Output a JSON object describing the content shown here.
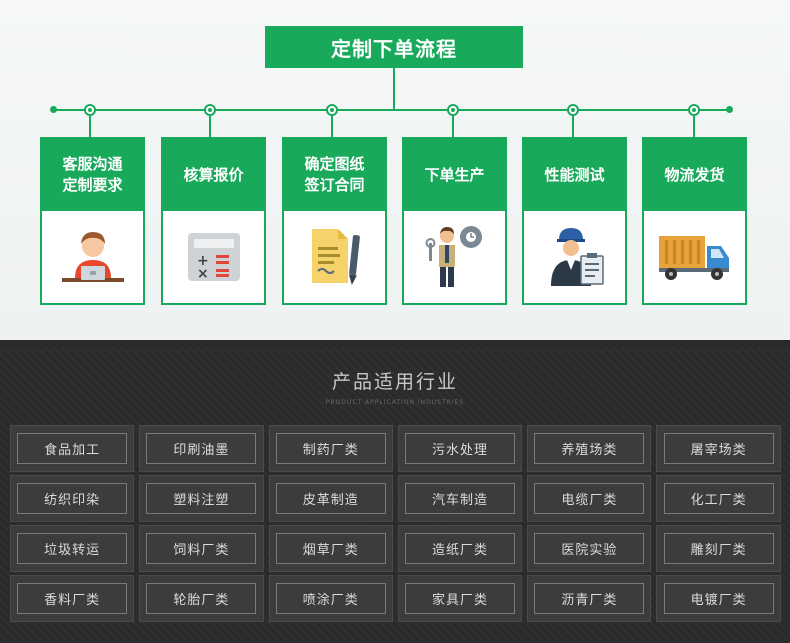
{
  "process": {
    "title": "定制下单流程",
    "steps": [
      {
        "label": "客服沟通\n定制要求",
        "icon": "customer-service-icon"
      },
      {
        "label": "核算报价",
        "icon": "calculator-icon"
      },
      {
        "label": "确定图纸\n签订合同",
        "icon": "contract-icon"
      },
      {
        "label": "下单生产",
        "icon": "production-icon"
      },
      {
        "label": "性能测试",
        "icon": "inspection-icon"
      },
      {
        "label": "物流发货",
        "icon": "delivery-truck-icon"
      }
    ]
  },
  "industries": {
    "title": "产品适用行业",
    "subtitle": "PRODUCT APPLICATION INDUSTRIES",
    "items": [
      "食品加工",
      "印刷油墨",
      "制药厂类",
      "污水处理",
      "养殖场类",
      "屠宰场类",
      "纺织印染",
      "塑料注塑",
      "皮革制造",
      "汽车制造",
      "电缆厂类",
      "化工厂类",
      "垃圾转运",
      "饲料厂类",
      "烟草厂类",
      "造纸厂类",
      "医院实验",
      "雕刻厂类",
      "香料厂类",
      "轮胎厂类",
      "喷涂厂类",
      "家具厂类",
      "沥青厂类",
      "电镀厂类"
    ]
  },
  "colors": {
    "accent_green": "#18a95a",
    "dark_bg": "#2b2b2b"
  }
}
